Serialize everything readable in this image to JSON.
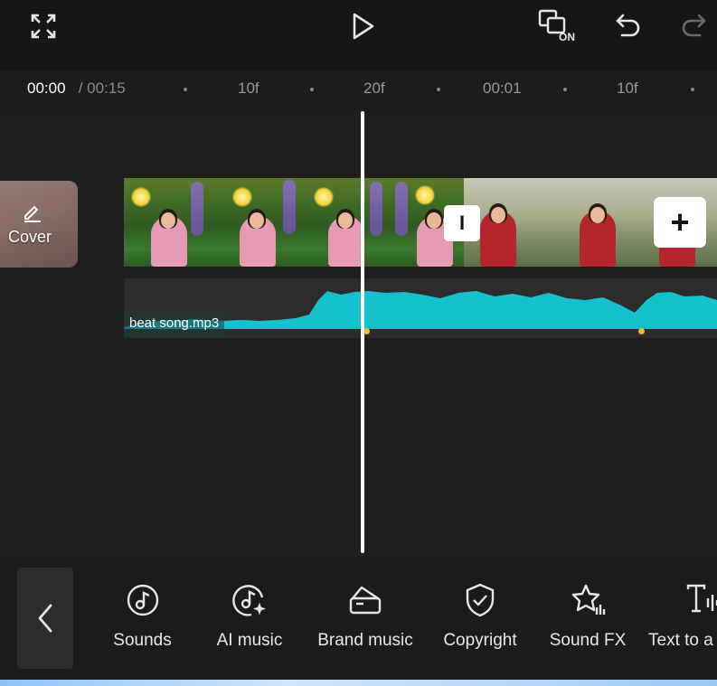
{
  "toolbar": {
    "fullscreen_icon": "fullscreen-icon",
    "play_icon": "play-icon",
    "toggle_badge": "ON",
    "undo_icon": "undo-icon",
    "redo_icon": "redo-icon"
  },
  "ruler": {
    "current_time": "00:00",
    "total_time": " / 00:15",
    "ticks": [
      "10f",
      "20f",
      "00:01",
      "10f"
    ]
  },
  "cover": {
    "label": "Cover"
  },
  "audio": {
    "file_name": "beat song.mp3"
  },
  "split_button": {
    "symbol": "I"
  },
  "add_button": {
    "symbol": "+"
  },
  "tools": [
    {
      "label": "Sounds",
      "icon": "music-note-icon"
    },
    {
      "label": "AI music",
      "icon": "ai-music-icon"
    },
    {
      "label": "Brand music",
      "icon": "brand-music-icon"
    },
    {
      "label": "Copyright",
      "icon": "shield-check-icon"
    },
    {
      "label": "Sound FX",
      "icon": "star-sound-icon"
    },
    {
      "label": "Text to a",
      "icon": "text-to-audio-icon"
    }
  ],
  "colors": {
    "waveform": "#16c1ce",
    "keyframe": "#e8bb3a",
    "background": "#131313"
  }
}
